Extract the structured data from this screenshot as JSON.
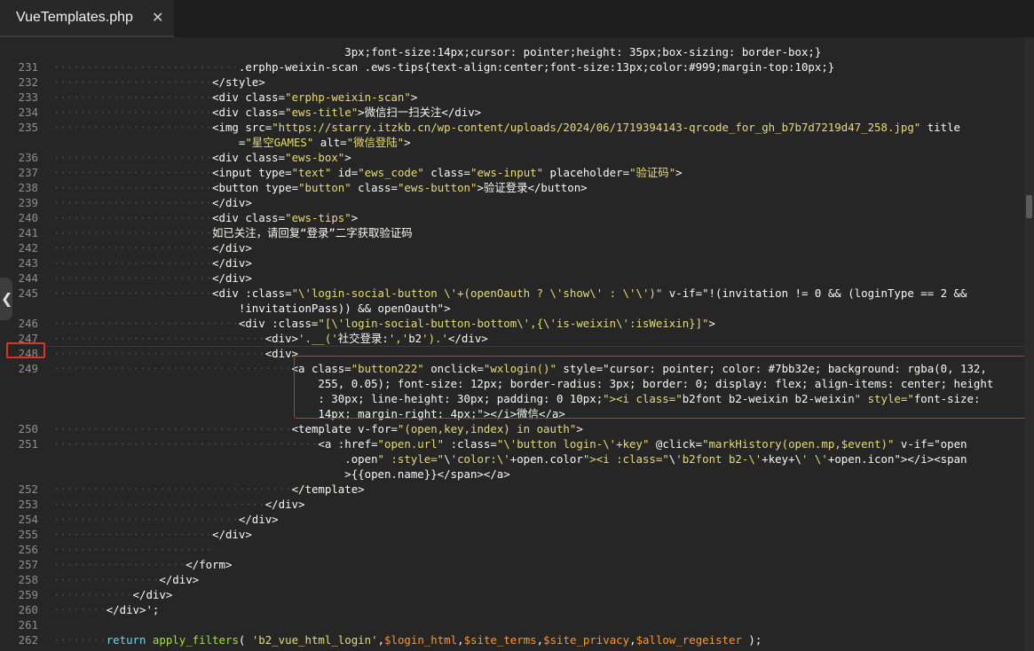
{
  "tab": {
    "title": "VueTemplates.php",
    "close_glyph": "✕",
    "close_icon": "close-icon"
  },
  "side_handle": {
    "glyph": "❮",
    "icon": "chevron-left-icon"
  },
  "colors": {
    "background": "#262626",
    "line_number": "#8e8e8e",
    "string": "#e6db74",
    "keyword": "#66d9ef",
    "function": "#a6e22e",
    "variable": "#fd971f",
    "highlight_box": "#d12f2a"
  },
  "editor": {
    "highlighted_line_number": "248",
    "lines": [
      {
        "n": "",
        "ws": "···········",
        "code": "   ",
        "raw": "              ·   ·       ·      ·    ·    ·       ·      ·       ·                     ·              ·     ·"
      },
      {
        "n": "",
        "ws": "",
        "code": "                                            3px;font-size:14px;cursor: pointer;height: 35px;box-sizing: border-box;}"
      },
      {
        "n": "231",
        "ws": "····························",
        "code": ".erphp-weixin-scan .ews-tips{text-align:center;font-size:13px;color:#999;margin-top:10px;}"
      },
      {
        "n": "232",
        "ws": "························",
        "code": "</style>"
      },
      {
        "n": "233",
        "ws": "························",
        "code": "<div class=\"erphp-weixin-scan\">"
      },
      {
        "n": "234",
        "ws": "························",
        "code": "<div class=\"ews-title\">微信扫一扫关注</div>"
      },
      {
        "n": "235",
        "ws": "························",
        "code": "<img src=\"https://starry.itzkb.cn/wp-content/uploads/2024/06/1719394143-qrcode_for_gh_b7b7d7219d47_258.jpg\" title"
      },
      {
        "n": "",
        "ws": "",
        "code": "                            =\"星空GAMES\" alt=\"微信登陆\">"
      },
      {
        "n": "236",
        "ws": "························",
        "code": "<div class=\"ews-box\">"
      },
      {
        "n": "237",
        "ws": "························",
        "code": "<input type=\"text\" id=\"ews_code\" class=\"ews-input\" placeholder=\"验证码\">"
      },
      {
        "n": "238",
        "ws": "························",
        "code": "<button type=\"button\" class=\"ews-button\">验证登录</button>"
      },
      {
        "n": "239",
        "ws": "························",
        "code": "</div>"
      },
      {
        "n": "240",
        "ws": "························",
        "code": "<div class=\"ews-tips\">"
      },
      {
        "n": "241",
        "ws": "························",
        "code": "如已关注，请回复“登录”二字获取验证码"
      },
      {
        "n": "242",
        "ws": "························",
        "code": "</div>"
      },
      {
        "n": "243",
        "ws": "························",
        "code": "</div>"
      },
      {
        "n": "244",
        "ws": "························",
        "code": "</div>"
      },
      {
        "n": "245",
        "ws": "························",
        "code": "<div :class=\"\\'login-social-button \\'+(openOauth ? \\'show\\' : \\'\\')\" v-if=\"!(invitation != 0 && (loginType == 2 &&"
      },
      {
        "n": "",
        "ws": "",
        "code": "                            !invitationPass)) && openOauth\">"
      },
      {
        "n": "246",
        "ws": "····························",
        "code": "<div :class=\"[\\'login-social-button-bottom\\',{\\'is-weixin\\':isWeixin}]\">"
      },
      {
        "n": "247",
        "ws": "································",
        "code": "<div>'.__('社交登录:','b2').'</div>"
      },
      {
        "n": "248",
        "ws": "································",
        "code": "<div>"
      },
      {
        "n": "249",
        "ws": "····································",
        "code": "<a class=\"button222\" onclick=\"wxlogin()\" style=\"cursor: pointer; color: #7bb32e; background: rgba(0, 132,"
      },
      {
        "n": "",
        "ws": "",
        "code": "                                        255, 0.05); font-size: 12px; border-radius: 3px; border: 0; display: flex; align-items: center; height"
      },
      {
        "n": "",
        "ws": "",
        "code": "                                        : 30px; line-height: 30px; padding: 0 10px;\"><i class=\"b2font b2-weixin b2-weixin\" style=\"font-size:"
      },
      {
        "n": "",
        "ws": "",
        "code": "                                        14px; margin-right: 4px;\"></i>微信</a>"
      },
      {
        "n": "250",
        "ws": "····································",
        "code": "<template v-for=\"(open,key,index) in oauth\">"
      },
      {
        "n": "251",
        "ws": "········································",
        "code": "<a :href=\"open.url\" :class=\"\\'button login-\\'+key\" @click=\"markHistory(open.mp,$event)\" v-if=\"open"
      },
      {
        "n": "",
        "ws": "",
        "code": "                                            .open\" :style=\"\\'color:\\'+open.color\"><i :class=\"\\'b2font b2-\\'+key+\\' \\'+open.icon\"></i><span"
      },
      {
        "n": "",
        "ws": "",
        "code": "                                            >{{open.name}}</span></a>"
      },
      {
        "n": "252",
        "ws": "····································",
        "code": "</template>"
      },
      {
        "n": "253",
        "ws": "································",
        "code": "</div>"
      },
      {
        "n": "254",
        "ws": "····························",
        "code": "</div>"
      },
      {
        "n": "255",
        "ws": "························",
        "code": "</div>"
      },
      {
        "n": "256",
        "ws": "························",
        "code": ""
      },
      {
        "n": "257",
        "ws": "····················",
        "code": "</form>"
      },
      {
        "n": "258",
        "ws": "················",
        "code": "</div>"
      },
      {
        "n": "259",
        "ws": "············",
        "code": "</div>"
      },
      {
        "n": "260",
        "ws": "········",
        "code": "</div>';"
      },
      {
        "n": "261",
        "ws": "",
        "code": ""
      },
      {
        "n": "262",
        "ws": "········",
        "code": "return apply_filters( 'b2_vue_html_login',$login_html,$site_terms,$site_privacy,$allow_regeister );"
      }
    ]
  }
}
